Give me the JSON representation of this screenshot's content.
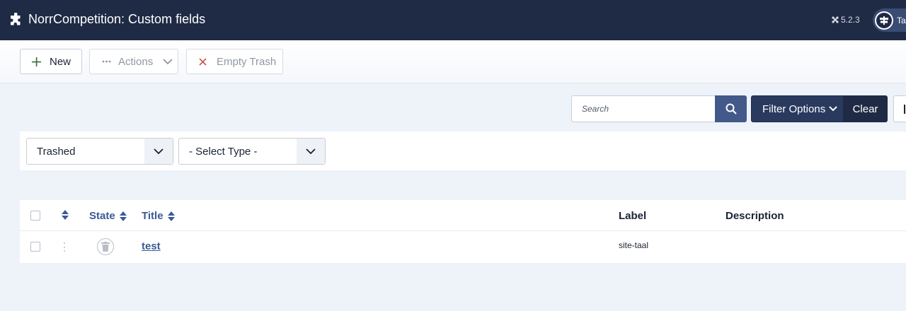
{
  "header": {
    "title": "NorrCompetition: Custom fields",
    "version": "5.2.3",
    "user_label": "Ta"
  },
  "toolbar": {
    "new_label": "New",
    "actions_label": "Actions",
    "empty_trash_label": "Empty Trash"
  },
  "search": {
    "placeholder": "Search",
    "filter_options_label": "Filter Options",
    "clear_label": "Clear"
  },
  "filters": {
    "state_selected": "Trashed",
    "type_selected": "- Select Type -"
  },
  "table": {
    "columns": {
      "state": "State",
      "title": "Title",
      "label": "Label",
      "description": "Description"
    },
    "rows": [
      {
        "title": "test",
        "label": "site-taal",
        "description": ""
      }
    ]
  },
  "colors": {
    "header_bg": "#1f2b45",
    "accent": "#43598a",
    "link": "#3a5a97"
  }
}
